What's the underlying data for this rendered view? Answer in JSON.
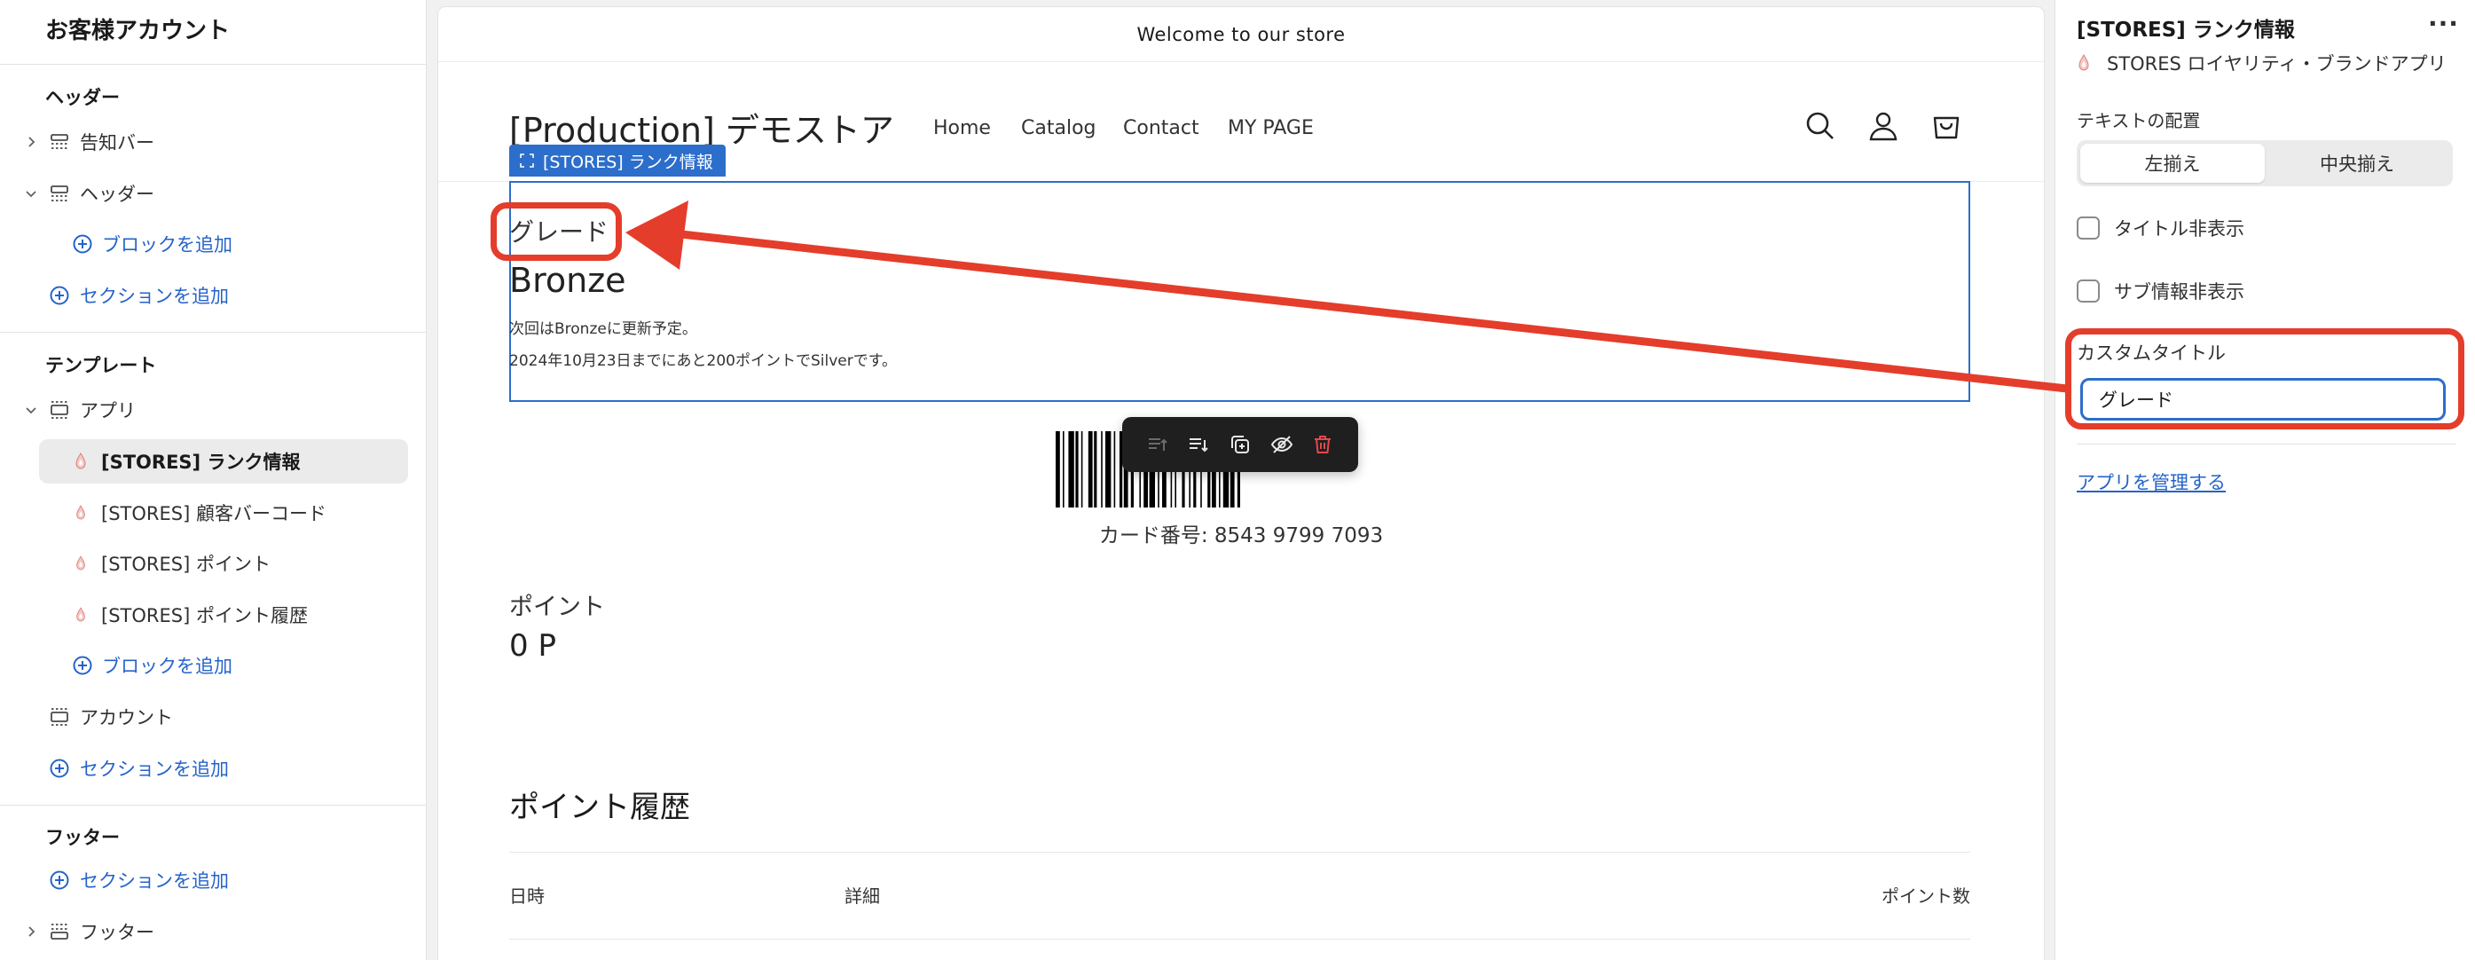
{
  "sidebar": {
    "title": "お客様アカウント",
    "header_section": "ヘッダー",
    "announcement_bar": "告知バー",
    "header": "ヘッダー",
    "add_block": "ブロックを追加",
    "add_section": "セクションを追加",
    "template_section": "テンプレート",
    "app": "アプリ",
    "app_items": [
      "[STORES] ランク情報",
      "[STORES] 顧客バーコード",
      "[STORES] ポイント",
      "[STORES] ポイント履歴"
    ],
    "account": "アカウント",
    "footer_section": "フッター",
    "footer": "フッター"
  },
  "preview": {
    "announcement": "Welcome to our store",
    "logo": "[Production] デモストア",
    "nav": [
      "Home",
      "Catalog",
      "Contact",
      "MY PAGE"
    ],
    "block_tag": "[STORES] ランク情報",
    "grade_label": "グレード",
    "grade_value": "Bronze",
    "rank_note_1": "次回はBronzeに更新予定。",
    "rank_note_2": "2024年10月23日までにあと200ポイントでSilverです。",
    "card_number": "カード番号: 8543 9799 7093",
    "points_label": "ポイント",
    "points_value": "0 P",
    "history_title": "ポイント履歴",
    "history_columns": [
      "日時",
      "詳細",
      "ポイント数"
    ]
  },
  "settings": {
    "title": "[STORES] ランク情報",
    "more": "···",
    "app_name": "STORES ロイヤリティ・ブランドアプリ",
    "alignment_label": "テキストの配置",
    "alignment_options": [
      "左揃え",
      "中央揃え"
    ],
    "alignment_selected": "左揃え",
    "hide_title": "タイトル非表示",
    "hide_sub_info": "サブ情報非表示",
    "custom_title_label": "カスタムタイトル",
    "custom_title_value": "グレード",
    "manage_app": "アプリを管理する"
  },
  "colors": {
    "accent": "#2c6ecb",
    "link": "#2563c9",
    "annotation": "#e43d2b",
    "delete": "#e5484d"
  }
}
